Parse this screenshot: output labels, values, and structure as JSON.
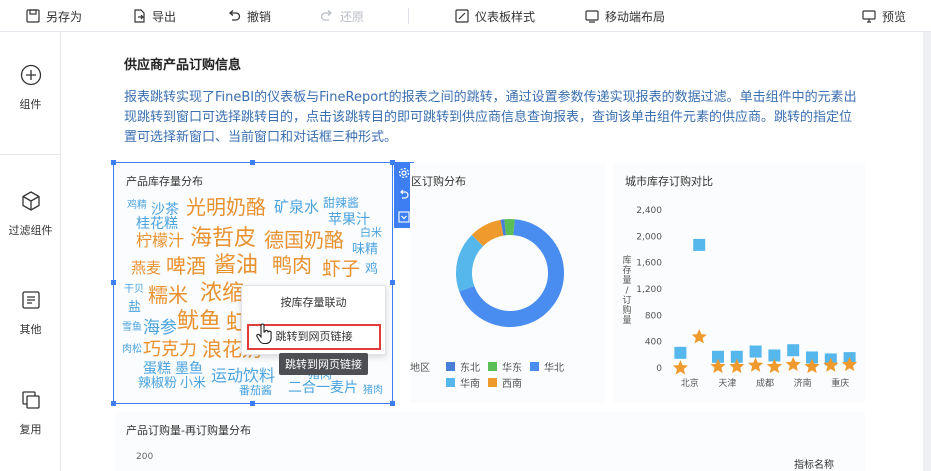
{
  "toolbar": {
    "save_as": "另存为",
    "export": "导出",
    "undo": "撤销",
    "redo": "还原",
    "dashboard_style": "仪表板样式",
    "mobile_layout": "移动端布局",
    "preview": "预览"
  },
  "sidebar": {
    "items": [
      {
        "label": "组件",
        "icon": "plus-circle-icon"
      },
      {
        "label": "过滤组件",
        "icon": "cube-icon"
      },
      {
        "label": "其他",
        "icon": "text-doc-icon"
      },
      {
        "label": "复用",
        "icon": "layers-icon"
      }
    ]
  },
  "page": {
    "title": "供应商产品订购信息",
    "description": "报表跳转实现了FineBI的仪表板与FineReport的报表之间的跳转，通过设置参数传递实现报表的数据过滤。单击组件中的元素出现跳转到窗口可选择跳转目的，点击该跳转目的即可跳转到供应商信息查询报表，查询该单击组件元素的供应商。跳转的指定位置可选择新窗口、当前窗口和对话框三种形式。"
  },
  "word_cloud": {
    "title": "产品库存量分布",
    "words": [
      {
        "text": "鸡精",
        "color": "#4aa3df"
      },
      {
        "text": "沙茶",
        "color": "#4aa3df"
      },
      {
        "text": "光明奶酪",
        "color": "#e8912f"
      },
      {
        "text": "矿泉水",
        "color": "#4aa3df"
      },
      {
        "text": "甜辣酱",
        "color": "#4aa3df"
      },
      {
        "text": "桂花糕",
        "color": "#4aa3df"
      },
      {
        "text": "苹果汁",
        "color": "#4aa3df"
      },
      {
        "text": "柠檬汁",
        "color": "#e8912f"
      },
      {
        "text": "海哲皮",
        "color": "#e8912f"
      },
      {
        "text": "德国奶酪",
        "color": "#e8912f"
      },
      {
        "text": "白米",
        "color": "#4aa3df"
      },
      {
        "text": "味精",
        "color": "#4aa3df"
      },
      {
        "text": "燕麦",
        "color": "#e8912f"
      },
      {
        "text": "啤酒",
        "color": "#e8912f"
      },
      {
        "text": "酱油",
        "color": "#e8912f"
      },
      {
        "text": "鸭肉",
        "color": "#e8912f"
      },
      {
        "text": "虾子",
        "color": "#e8912f"
      },
      {
        "text": "鸡",
        "color": "#4aa3df"
      },
      {
        "text": "干贝",
        "color": "#4aa3df"
      },
      {
        "text": "糯米",
        "color": "#e8912f"
      },
      {
        "text": "浓缩",
        "color": "#e8912f"
      },
      {
        "text": "盐",
        "color": "#4aa3df"
      },
      {
        "text": "雪鱼",
        "color": "#4aa3df"
      },
      {
        "text": "海参",
        "color": "#4aa3df"
      },
      {
        "text": "鱿鱼",
        "color": "#e8912f"
      },
      {
        "text": "虹",
        "color": "#e8912f"
      },
      {
        "text": "肉松",
        "color": "#4aa3df"
      },
      {
        "text": "巧克力",
        "color": "#e8912f"
      },
      {
        "text": "浪花奶",
        "color": "#e8912f"
      },
      {
        "text": "蛋糕",
        "color": "#4aa3df"
      },
      {
        "text": "墨鱼",
        "color": "#4aa3df"
      },
      {
        "text": "运动饮料",
        "color": "#4aa3df"
      },
      {
        "text": "猪肉",
        "color": "#4aa3df"
      },
      {
        "text": "辣椒粉",
        "color": "#4aa3df"
      },
      {
        "text": "小米",
        "color": "#4aa3df"
      },
      {
        "text": "番茄酱",
        "color": "#4aa3df"
      },
      {
        "text": "二合一麦片",
        "color": "#4aa3df"
      },
      {
        "text": "猪肉",
        "color": "#4aa3df"
      }
    ]
  },
  "context_menu": {
    "item_link": "按库存量联动",
    "item_jump": "跳转到网页链接",
    "tooltip": "跳转到网页链接"
  },
  "donut": {
    "title": "地区订购分布",
    "legend_title": "地区",
    "legend": [
      {
        "name": "东北",
        "color": "#4a7fd8"
      },
      {
        "name": "华东",
        "color": "#5bbf58"
      },
      {
        "name": "华北",
        "color": "#4a8df0"
      },
      {
        "name": "华南",
        "color": "#55b7ec"
      },
      {
        "name": "西南",
        "color": "#ef9a2d"
      }
    ]
  },
  "chart_data": {
    "type": "scatter",
    "title": "城市库存订购对比",
    "ylabel": "库存量/订购量",
    "ylim": [
      0,
      2400
    ],
    "yticks": [
      "0",
      "400",
      "800",
      "1,200",
      "1,600",
      "2,000",
      "2,400"
    ],
    "xticks": [
      "北京",
      "天津",
      "成都",
      "济南",
      "重庆"
    ],
    "series": [
      {
        "shape": "square",
        "color": "#55b7ec",
        "values": [
          230,
          1870,
          170,
          170,
          250,
          190,
          270,
          160,
          130,
          150
        ]
      },
      {
        "shape": "star",
        "color": "#ef9a2d",
        "values": [
          0,
          470,
          20,
          20,
          40,
          20,
          50,
          20,
          40,
          50
        ]
      }
    ]
  },
  "bottom_card": {
    "title": "产品订购量-再订购量分布",
    "y_tick": "200",
    "legend_title": "指标名称"
  }
}
